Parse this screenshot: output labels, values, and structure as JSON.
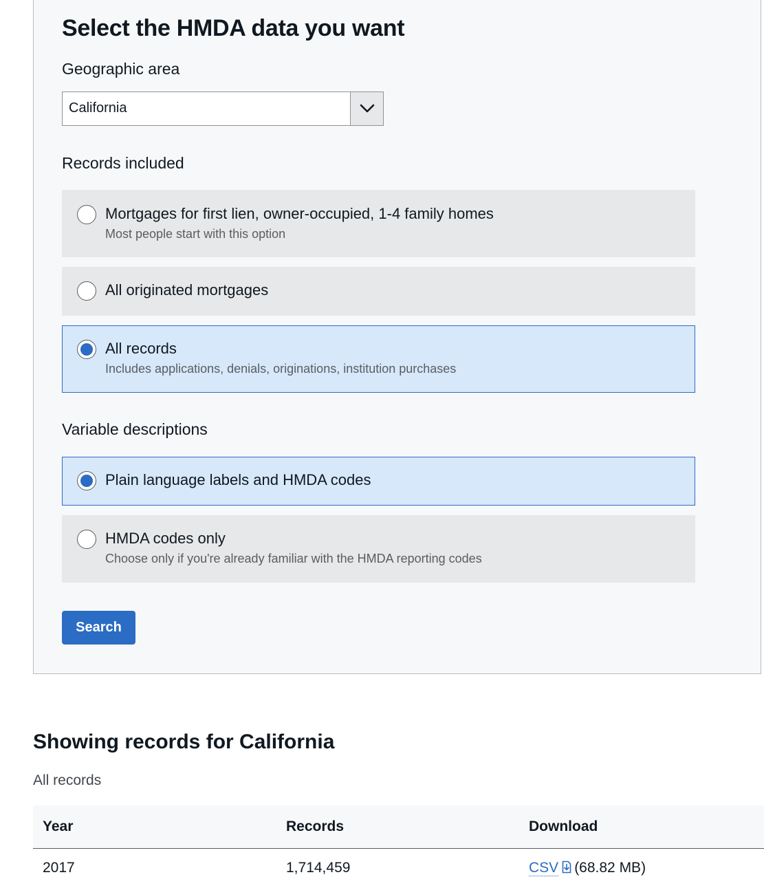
{
  "form": {
    "title": "Select the HMDA data you want",
    "geographic_area": {
      "label": "Geographic area",
      "selected": "California"
    },
    "records_included": {
      "label": "Records included",
      "options": [
        {
          "label": "Mortgages for first lien, owner-occupied, 1-4 family homes",
          "help": "Most people start with this option",
          "selected": false
        },
        {
          "label": "All originated mortgages",
          "help": "",
          "selected": false
        },
        {
          "label": "All records",
          "help": "Includes applications, denials, originations, institution purchases",
          "selected": true
        }
      ]
    },
    "variable_descriptions": {
      "label": "Variable descriptions",
      "options": [
        {
          "label": "Plain language labels and HMDA codes",
          "help": "",
          "selected": true
        },
        {
          "label": "HMDA codes only",
          "help": "Choose only if you're already familiar with the HMDA reporting codes",
          "selected": false
        }
      ]
    },
    "search_label": "Search"
  },
  "results": {
    "title": "Showing records for California",
    "subtitle": "All records",
    "columns": [
      "Year",
      "Records",
      "Download"
    ],
    "rows": [
      {
        "year": "2017",
        "records": "1,714,459",
        "download_link": "CSV",
        "download_size": "(68.82 MB)"
      }
    ]
  },
  "colors": {
    "accent": "#2b6cc4",
    "selected_bg": "#d6e8fa",
    "option_bg": "#e7e8e9",
    "panel_bg": "#f7f8f9"
  }
}
